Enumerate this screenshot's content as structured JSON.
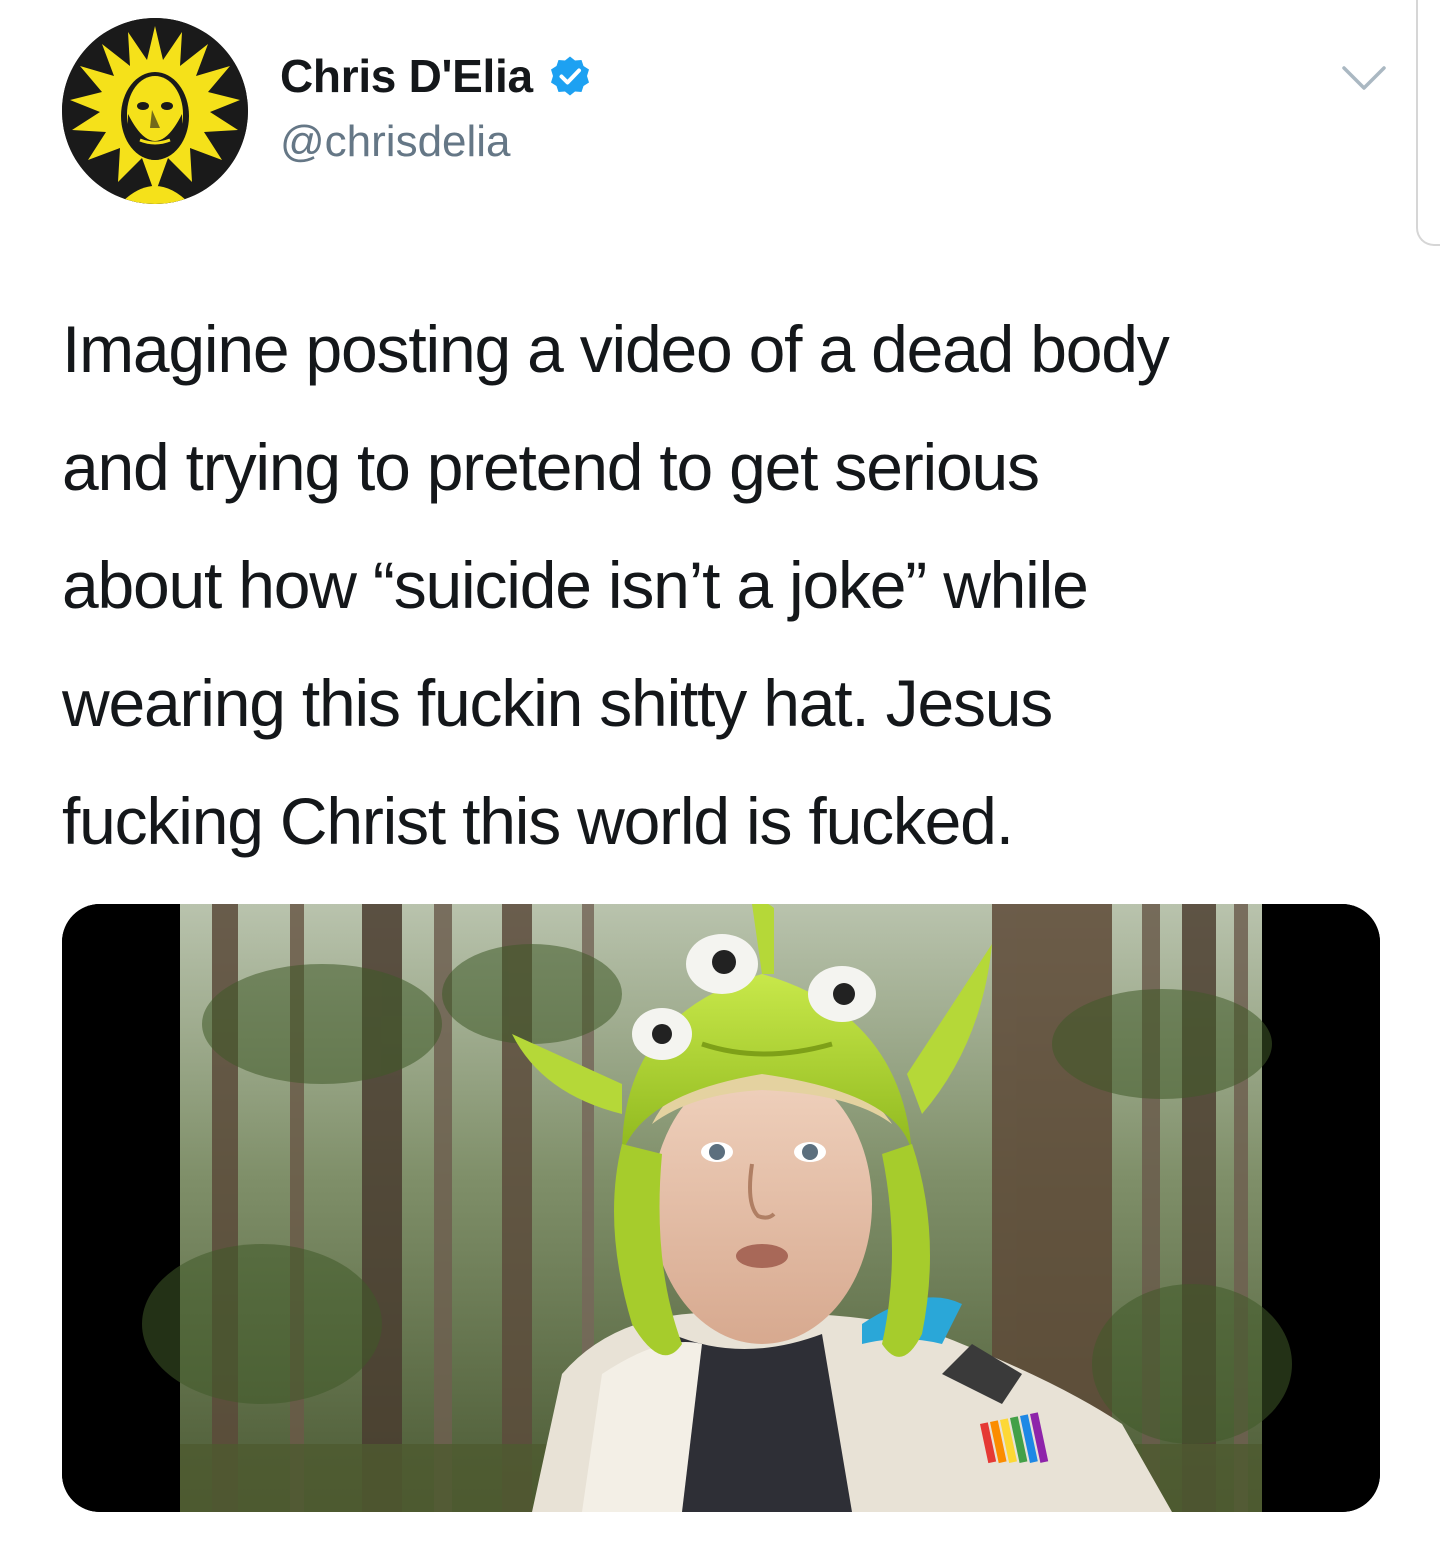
{
  "tweet": {
    "author": {
      "display_name": "Chris D'Elia",
      "handle": "@chrisdelia",
      "verified": true,
      "avatar_icon": "profile-photo-avatar"
    },
    "menu_icon": "chevron-down-icon",
    "text": "Imagine posting a video of a dead body\nand trying to pretend to get serious\nabout how “suicide isn’t a joke” while\nwearing this fuckin shitty hat. Jesus\nfucking Christ this world is fucked.",
    "media": {
      "type": "video-thumbnail"
    }
  },
  "colors": {
    "text_primary": "#14171a",
    "text_secondary": "#657786",
    "verified_blue": "#1da1f2",
    "chevron_gray": "#aab8c2",
    "avatar_yellow": "#f5e11a",
    "media_letterbox": "#000000"
  }
}
